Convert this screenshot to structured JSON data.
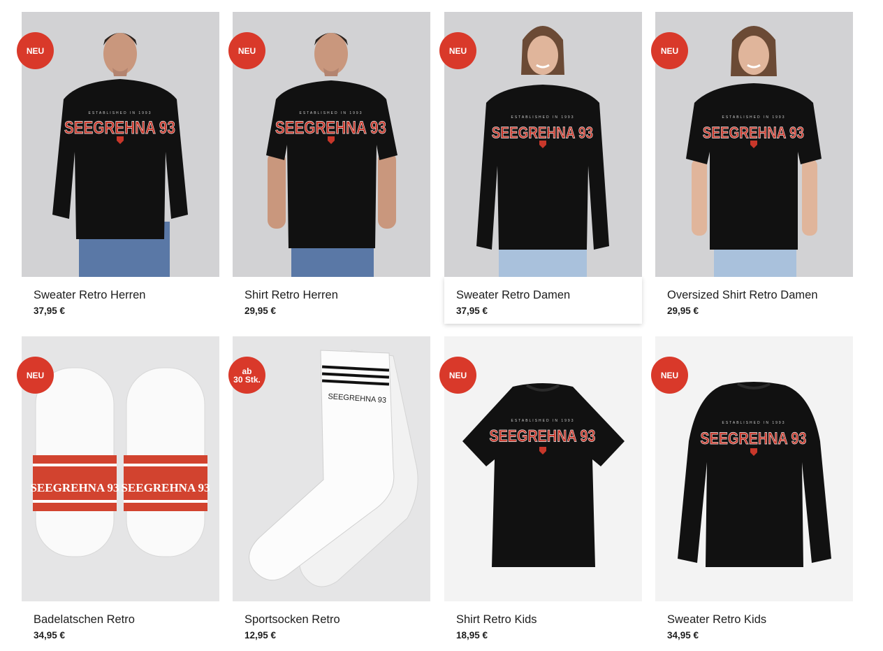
{
  "products": [
    {
      "name": "Sweater Retro Herren",
      "price": "37,95 €",
      "badge": "NEU"
    },
    {
      "name": "Shirt Retro Herren",
      "price": "29,95 €",
      "badge": "NEU"
    },
    {
      "name": "Sweater Retro Damen",
      "price": "37,95 €",
      "badge": "NEU"
    },
    {
      "name": "Oversized Shirt Retro Damen",
      "price": "29,95 €",
      "badge": "NEU"
    },
    {
      "name": "Badelatschen Retro",
      "price": "34,95 €",
      "badge": "NEU"
    },
    {
      "name": "Sportsocken Retro",
      "price": "12,95 €",
      "badge_line1": "ab",
      "badge_line2": "30 Stk."
    },
    {
      "name": "Shirt Retro Kids",
      "price": "18,95 €",
      "badge": "NEU"
    },
    {
      "name": "Sweater Retro Kids",
      "price": "34,95 €",
      "badge": "NEU"
    }
  ],
  "print": {
    "brand": "SEEGREHNA 93",
    "tagline": "ESTABLISHED IN 1993",
    "slipper_text": "SEEGREHNA 93",
    "sock_text": "SEEGREHNA 93"
  },
  "colors": {
    "badge": "#d9392a",
    "print_red": "#c8372a",
    "garment": "#111111"
  }
}
